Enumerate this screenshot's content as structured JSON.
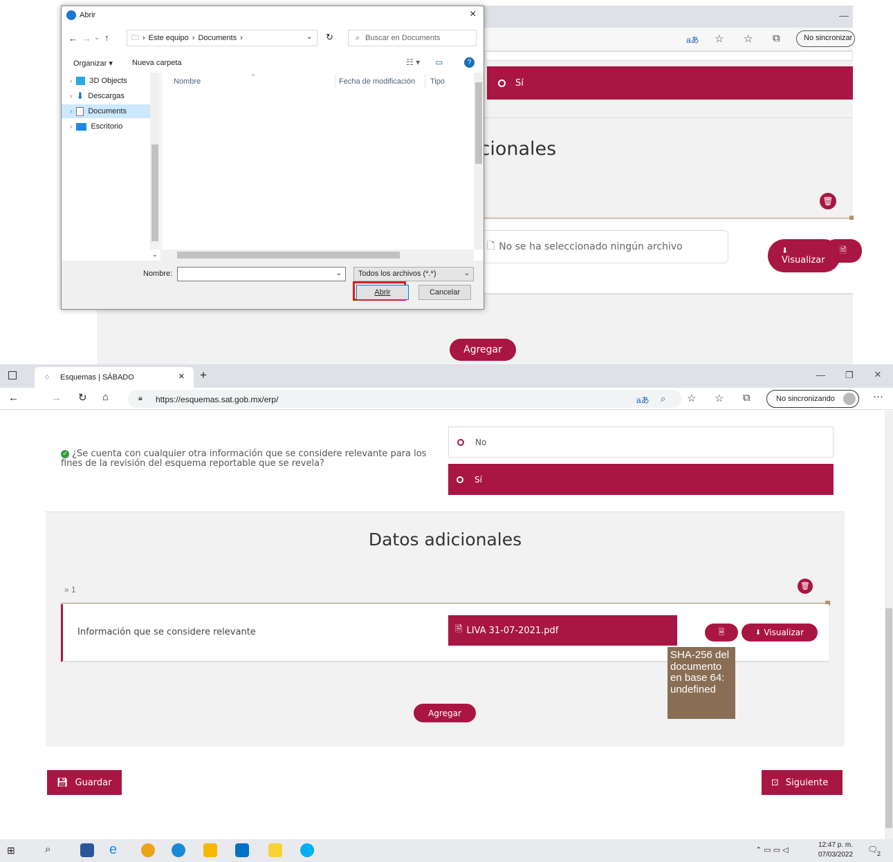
{
  "top_browser": {
    "sync_label": "No sincronizar",
    "option_si": "Sí",
    "heading_fragment": "icionales",
    "no_file_text": "No se ha seleccionado ningún archivo",
    "visualizar_label": "Visualizar",
    "agregar_label": "Agregar"
  },
  "dialog": {
    "title": "Abrir",
    "breadcrumb": [
      "Este equipo",
      "Documents"
    ],
    "search_placeholder": "Buscar en Documents",
    "organize_label": "Organizar ▾",
    "new_folder_label": "Nueva carpeta",
    "tree": [
      {
        "label": "3D Objects",
        "icon": "cube-icon"
      },
      {
        "label": "Descargas",
        "icon": "download-icon"
      },
      {
        "label": "Documents",
        "icon": "document-icon",
        "selected": true
      },
      {
        "label": "Escritorio",
        "icon": "desktop-icon"
      }
    ],
    "columns": [
      "Nombre",
      "Fecha de modificación",
      "Tipo"
    ],
    "filename_label": "Nombre:",
    "filename_value": "",
    "filter_value": "Todos los archivos (*.*)",
    "open_label": "Abrir",
    "cancel_label": "Cancelar"
  },
  "browser": {
    "tab_title": "Esquemas | SÁBADO",
    "url": "https://esquemas.sat.gob.mx/erp/",
    "sync_label": "No sincronizando"
  },
  "page": {
    "question": "¿Se cuenta con cualquier otra información que se considere relevante para los fines de la revisión del esquema reportable que se revela?",
    "option_no": "No",
    "option_si": "Sí",
    "section_title": "Datos adicionales",
    "item_index": "» 1",
    "field_label": "Información que se considere relevante",
    "file_name": "LIVA 31-07-2021.pdf",
    "visualizar_label": "Visualizar",
    "tooltip": "SHA-256 del documento en base 64: undefined",
    "agregar_label": "Agregar",
    "guardar_label": "Guardar",
    "siguiente_label": "Siguiente"
  },
  "taskbar": {
    "time": "12:47 p. m.",
    "date": "07/03/2022",
    "notif_count": "2"
  },
  "colors": {
    "brand": "#a91643",
    "tooltip": "#8a6d55"
  }
}
